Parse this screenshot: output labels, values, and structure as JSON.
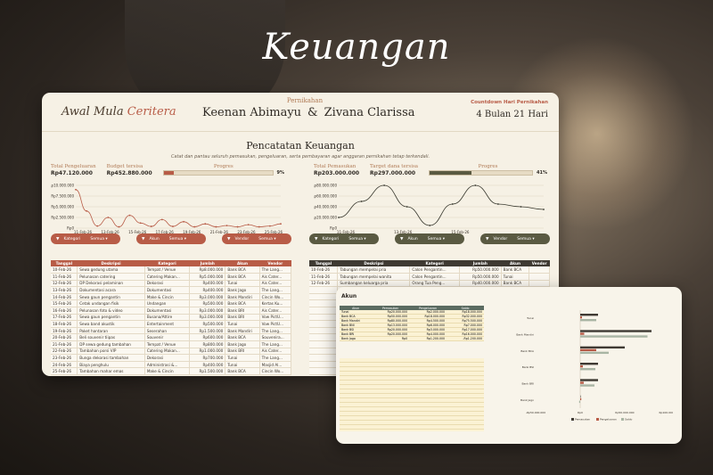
{
  "hero": {
    "title": "Keuangan"
  },
  "header": {
    "logo_main": "Awal Mula",
    "logo_accent": "Ceritera",
    "subtitle": "Pernikahan",
    "groom": "Keenan Abimayu",
    "amp": "&",
    "bride": "Zivana Clarissa",
    "countdown_label": "Countdown Hari Pernikahan",
    "countdown_value": "4 Bulan  21 Hari"
  },
  "section": {
    "title": "Pencatatan Keuangan",
    "subtitle": "Catat dan pantau seluruh pemasukan, pengeluaran, serta pembayaran agar anggaran pernikahan tetap terkendali."
  },
  "expense_panel": {
    "total_label": "Total Pengeluaran",
    "total_value": "Rp47.120.000",
    "budget_label": "Budget tersisa",
    "budget_value": "Rp452.880.000",
    "progress_label": "Progres",
    "progress_value": "9%",
    "progress_fraction": 0.09,
    "color": "#b85c47"
  },
  "income_panel": {
    "total_label": "Total Pemasukan",
    "total_value": "Rp203.000.000",
    "target_label": "Target dana tersisa",
    "target_value": "Rp297.000.000",
    "progress_label": "Progres",
    "progress_value": "41%",
    "progress_fraction": 0.41,
    "color": "#5a5a42"
  },
  "chart_data": [
    {
      "type": "line",
      "y_ticks": [
        "Rp10.000.000",
        "Rp7.500.000",
        "Rp5.000.000",
        "Rp2.500.000",
        "Rp0"
      ],
      "ylim": [
        0,
        10000000
      ],
      "x_ticks": [
        "11-Feb-26",
        "13-Feb-26",
        "15-Feb-26",
        "17-Feb-26",
        "19-Feb-26",
        "21-Feb-26",
        "23-Feb-26",
        "25-Feb-26"
      ],
      "values": [
        9000000,
        4000000,
        500000,
        2500000,
        300000,
        3000000,
        1200000,
        400000,
        2000000,
        400000,
        1500000,
        300000,
        1000000,
        300000,
        600000,
        300000,
        800000,
        300000,
        500000,
        1000000
      ],
      "color": "#b85c47"
    },
    {
      "type": "line",
      "y_ticks": [
        "Rp80.000.000",
        "Rp60.000.000",
        "Rp40.000.000",
        "Rp20.000.000",
        "Rp0"
      ],
      "ylim": [
        0,
        80000000
      ],
      "x_ticks": [
        "11-Feb-26",
        "13-Feb-26",
        "15-Feb-26"
      ],
      "values": [
        20000000,
        50000000,
        80000000,
        40000000,
        5000000,
        45000000,
        80000000,
        45000000,
        40000000,
        35000000
      ],
      "color": "#3a3a30"
    }
  ],
  "filters_left": [
    {
      "label": "Kategori",
      "value": "Semua"
    },
    {
      "label": "Akun",
      "value": "Semua"
    },
    {
      "label": "Vendor",
      "value": "Semua"
    }
  ],
  "filters_right": [
    {
      "label": "Kategori",
      "value": "Semua"
    },
    {
      "label": "Akun",
      "value": "Semua"
    },
    {
      "label": "Vendor",
      "value": "Semua"
    }
  ],
  "expense_table": {
    "headers": [
      "Tanggal",
      "Deskripsi",
      "Kategori",
      "Jumlah",
      "Akun",
      "Vendor"
    ],
    "rows": [
      [
        "10-Feb-26",
        "Sewa gedung utama",
        "Tempat / Venue",
        "Rp8.000.000",
        "Bank BCA",
        "The Lang..."
      ],
      [
        "11-Feb-26",
        "Pelunasan catering",
        "Catering Makan...",
        "Rp5.000.000",
        "Bank BCA",
        "Ais Cater..."
      ],
      [
        "12-Feb-26",
        "DP Dekorasi pelaminan",
        "Dekorasi",
        "Rp400.000",
        "Tunai",
        "Ais Cater..."
      ],
      [
        "13-Feb-26",
        "Dokumentasi acara",
        "Dokumentasi",
        "Rp400.000",
        "Bank Jago",
        "The Lang..."
      ],
      [
        "14-Feb-26",
        "Sewa gaun pengantin",
        "Make & Cincin",
        "Rp3.000.000",
        "Bank Mandiri",
        "Cincin Wo..."
      ],
      [
        "15-Feb-26",
        "Cetak undangan fisik",
        "Undangan",
        "Rp500.000",
        "Bank BCA",
        "Kertas Ku..."
      ],
      [
        "16-Feb-26",
        "Pelunasan foto & video",
        "Dokumentasi",
        "Rp3.000.000",
        "Bank BRI",
        "Ais Cater..."
      ],
      [
        "17-Feb-26",
        "Sewa gaun pengantin",
        "Busana/Attire",
        "Rp3.000.000",
        "Bank BRI",
        "Vow PictU..."
      ],
      [
        "18-Feb-26",
        "Sewa band akustik",
        "Entertainment",
        "Rp500.000",
        "Tunai",
        "Vow PictU..."
      ],
      [
        "19-Feb-26",
        "Paket hantaran",
        "Seserahan",
        "Rp1.500.000",
        "Bank Mandiri",
        "The Lang..."
      ],
      [
        "20-Feb-26",
        "Beli souvenir tiipas",
        "Souvenir",
        "Rp600.000",
        "Bank BCA",
        "Souvenira..."
      ],
      [
        "21-Feb-26",
        "DP sewa gedung tambahan",
        "Tempat / Venue",
        "Rp800.000",
        "Bank Jago",
        "The Lang..."
      ],
      [
        "22-Feb-26",
        "Tambahan porsi VIP",
        "Catering Makan...",
        "Rp1.000.000",
        "Bank BRI",
        "Ais Cater..."
      ],
      [
        "23-Feb-26",
        "Bunga dekorasi tambahan",
        "Dekorasi",
        "Rp700.000",
        "Tunai",
        "The Lang..."
      ],
      [
        "24-Feb-26",
        "Biaya penghulu",
        "Administrasi &...",
        "Rp400.000",
        "Tunai",
        "Masjid Al..."
      ],
      [
        "25-Feb-26",
        "Tambahan mahar emas",
        "Make & Cincin",
        "Rp1.500.000",
        "Bank BCA",
        "Cincin Wo..."
      ]
    ]
  },
  "income_table": {
    "headers": [
      "Tanggal",
      "Deskripsi",
      "Kategori",
      "Jumlah",
      "Akun",
      "Vendor"
    ],
    "rows": [
      [
        "10-Feb-26",
        "Tabungan mempelai pria",
        "Calon Pengantin...",
        "Rp50.000.000",
        "Bank BCA",
        ""
      ],
      [
        "11-Feb-26",
        "Tabungan mempelai wanita",
        "Calon Pengantin...",
        "Rp50.000.000",
        "Tunai",
        ""
      ],
      [
        "12-Feb-26",
        "Sumbangan keluarga pria",
        "Orang Tua Peng...",
        "Rp40.000.000",
        "Bank BCA",
        ""
      ]
    ],
    "empty_rows": 14
  },
  "akun_card": {
    "title": "Akun",
    "headers": [
      "Akun",
      "Pemasukan",
      "Pengeluaran",
      "Saldo"
    ],
    "rows": [
      [
        "Tunai",
        "Rp20.000.000",
        "Rp2.000.000",
        "Rp18.000.000"
      ],
      [
        "Bank BCA",
        "Rp50.000.000",
        "Rp18.000.000",
        "Rp32.000.000"
      ],
      [
        "Bank Mandiri",
        "Rp80.000.000",
        "Rp4.500.000",
        "Rp75.500.000"
      ],
      [
        "Bank BNI",
        "Rp13.000.000",
        "Rp6.000.000",
        "Rp7.000.000"
      ],
      [
        "Bank BSI",
        "Rp20.000.000",
        "Rp3.000.000",
        "Rp17.000.000"
      ],
      [
        "Bank BRI",
        "Rp20.000.000",
        "Rp4.000.000",
        "Rp16.000.000"
      ],
      [
        "Bank Jago",
        "Rp0",
        "Rp1.200.000",
        "-Rp1.200.000"
      ]
    ],
    "bar_chart": {
      "type": "bar",
      "categories": [
        "Tunai",
        "Bank Mandiri",
        "Bank BCA",
        "Bank BSI",
        "Bank BRI",
        "Bank Jago"
      ],
      "series": [
        {
          "name": "Pemasukan",
          "values": [
            20000000,
            80000000,
            50000000,
            20000000,
            20000000,
            0
          ],
          "color": "#3f3a33"
        },
        {
          "name": "Pengeluaran",
          "values": [
            2000000,
            4500000,
            18000000,
            3000000,
            4000000,
            1200000
          ],
          "color": "#b85c47"
        },
        {
          "name": "Saldo",
          "values": [
            18000000,
            75500000,
            32000000,
            17000000,
            16000000,
            -1200000
          ],
          "color": "#a9b5a4"
        }
      ],
      "x_ticks": [
        "-Rp50.000.000",
        "Rp0",
        "Rp50.000.000",
        "Rp100.000.000"
      ],
      "xlim": [
        -50000000,
        100000000
      ]
    }
  }
}
